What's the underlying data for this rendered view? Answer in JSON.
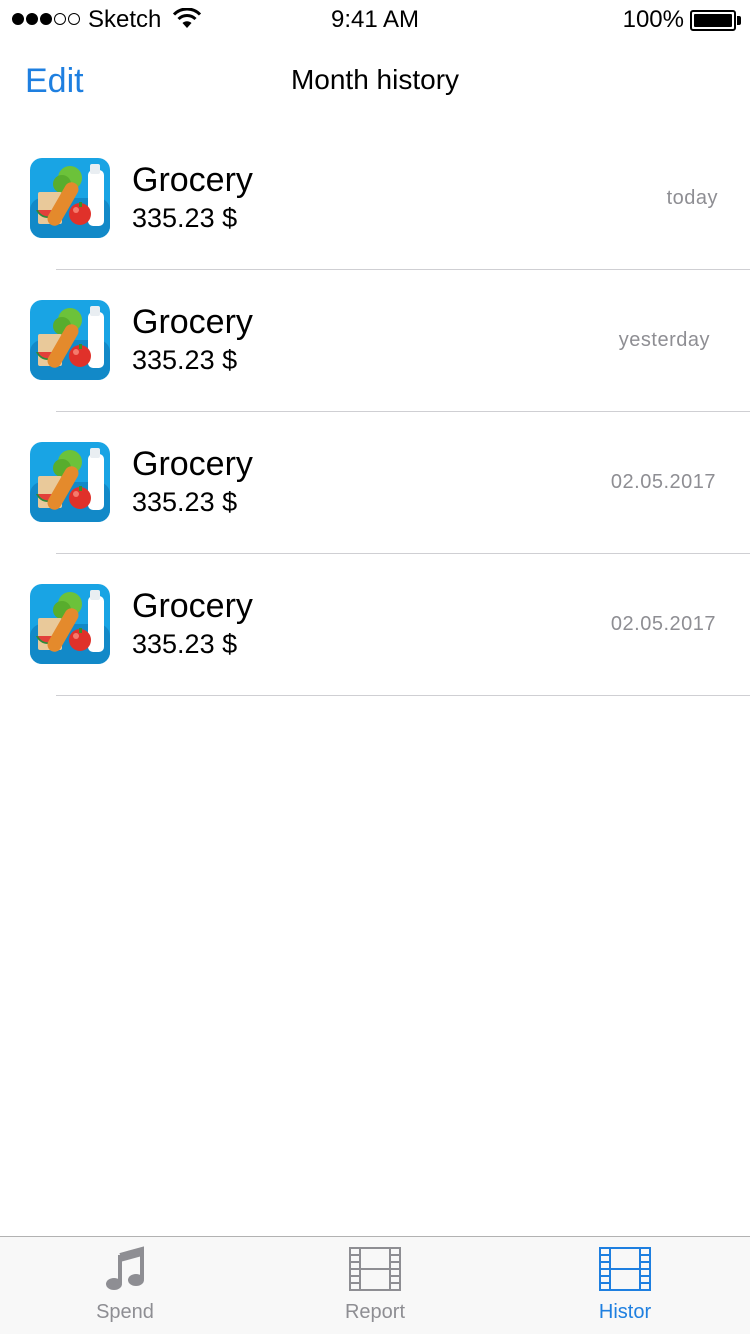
{
  "status_bar": {
    "carrier": "Sketch",
    "time": "9:41 AM",
    "battery": "100%"
  },
  "nav": {
    "edit_label": "Edit",
    "title": "Month history"
  },
  "rows": [
    {
      "title": "Grocery",
      "amount": "335.23 $",
      "date": "today",
      "icon": "grocery-icon"
    },
    {
      "title": "Grocery",
      "amount": "335.23 $",
      "date": "yesterday",
      "icon": "grocery-icon"
    },
    {
      "title": "Grocery",
      "amount": "335.23 $",
      "date": "02.05.2017",
      "icon": "grocery-icon"
    },
    {
      "title": "Grocery",
      "amount": "335.23 $",
      "date": "02.05.2017",
      "icon": "grocery-icon"
    }
  ],
  "tabs": [
    {
      "label": "Spend",
      "icon": "music-note-icon",
      "active": false
    },
    {
      "label": "Report",
      "icon": "film-strip-icon",
      "active": false
    },
    {
      "label": "Histor",
      "icon": "film-strip-icon",
      "active": true
    }
  ],
  "colors": {
    "accent": "#1e7fe0",
    "secondary_text": "#8e8e93",
    "separator": "#cfcfd3",
    "tab_bar_bg": "#f8f8f8"
  }
}
